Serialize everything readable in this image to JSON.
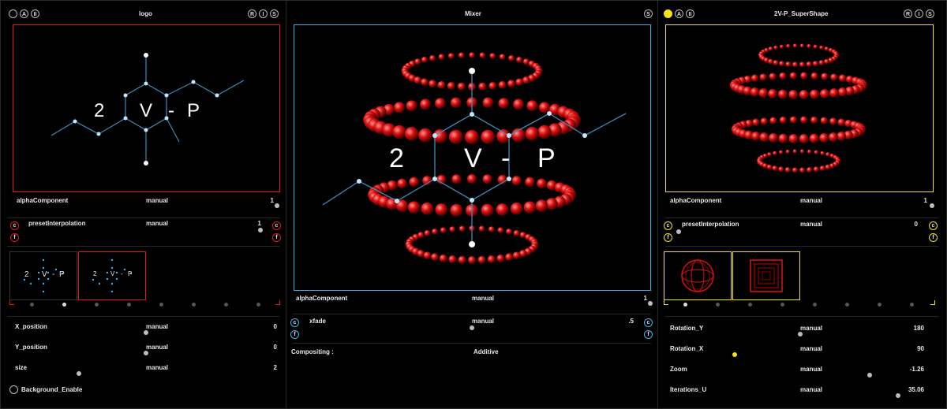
{
  "colors": {
    "red": "#e8161c",
    "blue": "#3db2e8",
    "yellow": "#f2e21a",
    "grey": "#9a9a9a"
  },
  "left": {
    "title": "logo",
    "header_buttons": [
      "A",
      "II"
    ],
    "right_buttons": [
      "R",
      "I",
      "S"
    ],
    "alpha": {
      "label": "alphaComponent",
      "mode": "manual",
      "value": "1"
    },
    "preset": {
      "label": "presetInterpolation",
      "mode": "manual",
      "value": "1",
      "c": "c",
      "f": "f"
    },
    "logo_text": [
      "2",
      "V",
      "-",
      "P"
    ],
    "thumb_text": [
      "2",
      "V",
      "-",
      "P"
    ],
    "params": [
      {
        "label": "X_position",
        "mode": "manual",
        "value": "0",
        "level": 0.5
      },
      {
        "label": "Y_position",
        "mode": "manual",
        "value": "0",
        "level": 0.5
      },
      {
        "label": "size",
        "mode": "manual",
        "value": "2",
        "level": 0.2
      }
    ],
    "bg_enable": "Background_Enable"
  },
  "mid": {
    "title": "Mixer",
    "right_button": "S",
    "logo_text": [
      "2",
      "V",
      "-",
      "P"
    ],
    "alpha": {
      "label": "alphaComponent",
      "mode": "manual",
      "value": "1"
    },
    "xfade": {
      "label": "xfade",
      "mode": "manual",
      "value": ".5",
      "c": "c",
      "f": "f"
    },
    "compositing": {
      "label": "Compositing :",
      "value": "Additive"
    }
  },
  "right": {
    "title": "2V-P_SuperShape",
    "header_buttons": [
      "",
      "A",
      "II"
    ],
    "right_buttons": [
      "R",
      "I",
      "S"
    ],
    "alpha": {
      "label": "alphaComponent",
      "mode": "manual",
      "value": "1"
    },
    "preset": {
      "label": "presetInterpolation",
      "mode": "manual",
      "value": "0",
      "c": "c",
      "f": "f"
    },
    "params": [
      {
        "label": "Rotation_Y",
        "mode": "manual",
        "value": "180"
      },
      {
        "label": "Rotation_X",
        "mode": "manual",
        "value": "90"
      },
      {
        "label": "Zoom",
        "mode": "manual",
        "value": "-1.26"
      },
      {
        "label": "Iterations_U",
        "mode": "manual",
        "value": "35.06"
      }
    ]
  }
}
